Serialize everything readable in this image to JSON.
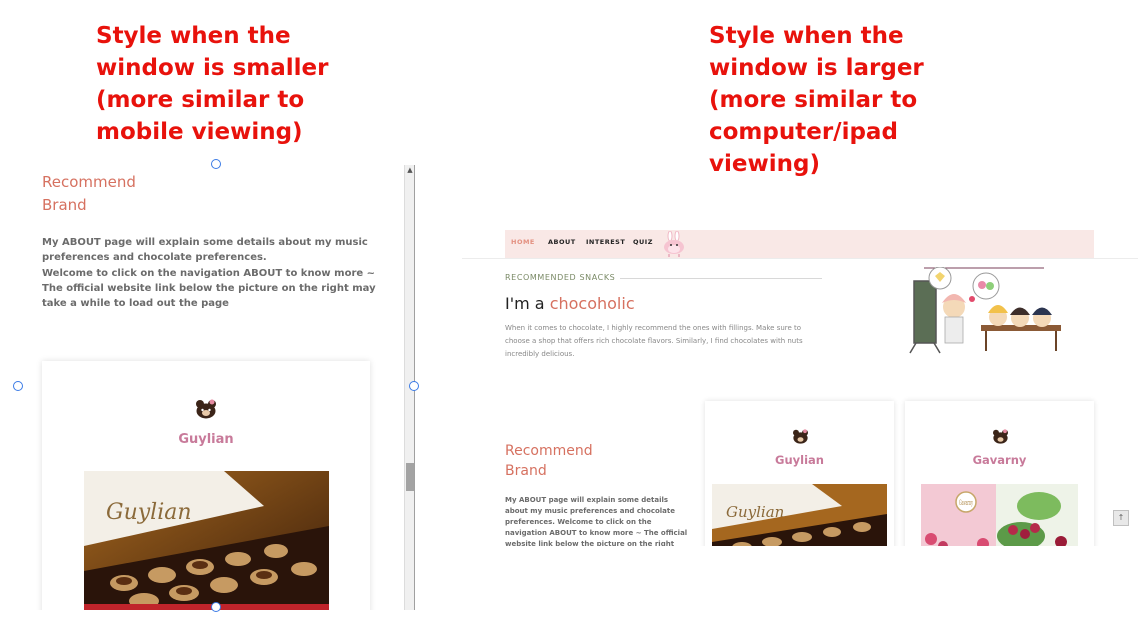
{
  "annotations": {
    "left": "Style when the\nwindow is smaller\n(more similar to\nmobile viewing)",
    "right": "Style when the\nwindow is larger\n(more similar to\ncomputer/ipad\nviewing)"
  },
  "colors": {
    "annotation_red": "#e8120c",
    "accent_salmon": "#d67160",
    "card_name_pink": "#c87a9a",
    "nav_background": "#f9e8e6"
  },
  "mobile": {
    "recommend_title": "Recommend\nBrand",
    "about_text": "My ABOUT page will explain some details about my music preferences and chocolate preferences.\nWelcome to click on the navigation ABOUT to know more ~\nThe official website link below the picture on the right may take a while to load out the page",
    "card": {
      "icon": "bear-chocolate-icon",
      "name": "Guylian",
      "photo_caption": "Guylian"
    },
    "scroll_up_glyph": "▲"
  },
  "desktop": {
    "nav": [
      {
        "label": "HOME",
        "active": true
      },
      {
        "label": "ABOUT",
        "active": false
      },
      {
        "label": "INTEREST",
        "active": false
      },
      {
        "label": "QUIZ",
        "active": false
      }
    ],
    "section_label": "RECOMMENDED SNACKS",
    "heading_prefix": "I'm a ",
    "heading_accent": "chocoholic",
    "intro_text": "When it comes to chocolate, I highly recommend the ones with fillings. Make sure to choose a shop that offers rich chocolate flavors. Similarly, I find chocolates with nuts incredibly delicious.",
    "recommend_title": "Recommend\nBrand",
    "about_text": "My ABOUT page will explain some details about my music preferences and chocolate preferences. Welcome to click on the navigation ABOUT to know more ~ The official website link below the picture on the right may take a while to load out the page",
    "cards": [
      {
        "icon": "bear-chocolate-icon",
        "name": "Guylian",
        "photo_caption": "Guylian"
      },
      {
        "icon": "bear-chocolate-icon",
        "name": "Gavarny",
        "photo_caption": "Gavarny"
      }
    ],
    "back_to_top_glyph": "↑"
  }
}
